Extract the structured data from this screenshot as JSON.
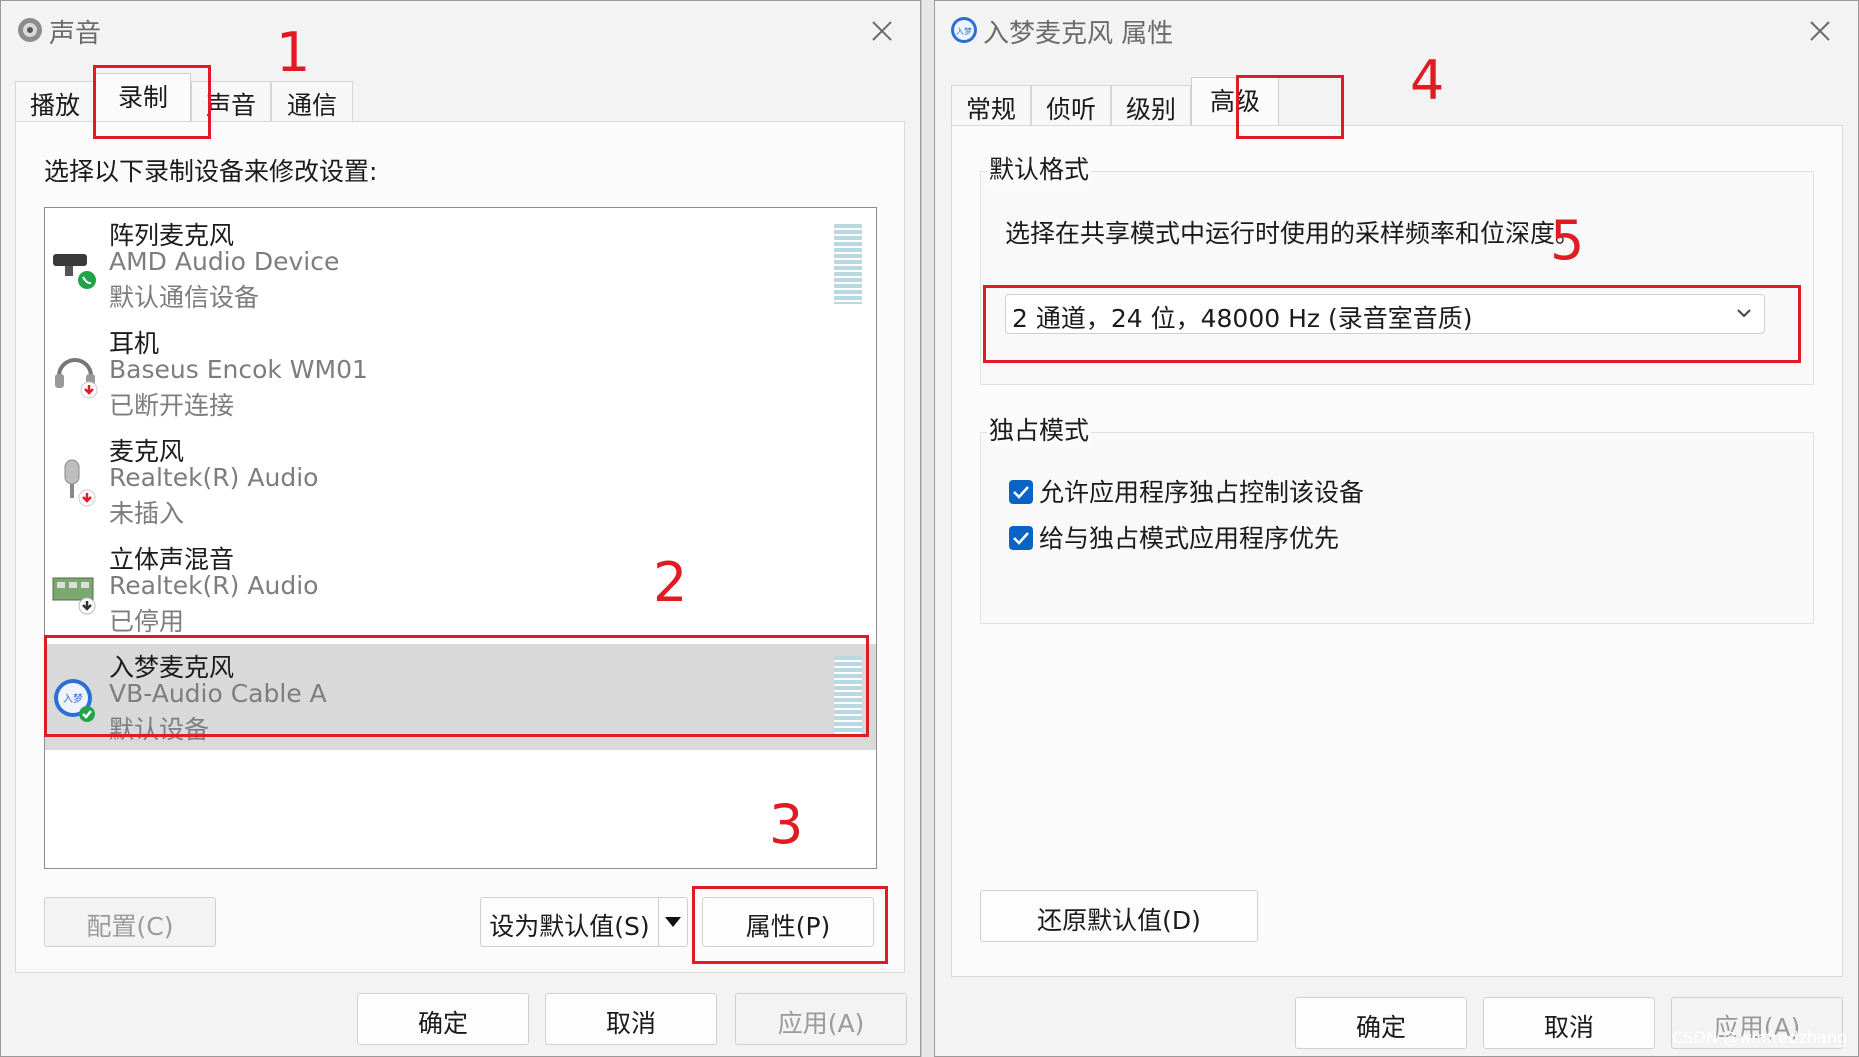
{
  "left_window": {
    "title": "声音",
    "tabs": [
      "播放",
      "录制",
      "声音",
      "通信"
    ],
    "active_tab": "录制",
    "instruction": "选择以下录制设备来修改设置:",
    "devices": [
      {
        "name": "阵列麦克风",
        "device": "AMD Audio Device",
        "status": "默认通信设备",
        "icon": "webcam-mic-icon",
        "badge": "phone-green-badge-icon"
      },
      {
        "name": "耳机",
        "device": "Baseus Encok WM01",
        "status": "已断开连接",
        "icon": "headset-icon",
        "badge": "arrow-red-badge-icon"
      },
      {
        "name": "麦克风",
        "device": "Realtek(R) Audio",
        "status": "未插入",
        "icon": "microphone-icon",
        "badge": "arrow-red-badge-icon"
      },
      {
        "name": "立体声混音",
        "device": "Realtek(R) Audio",
        "status": "已停用",
        "icon": "sound-card-icon",
        "badge": "arrow-down-badge-icon"
      },
      {
        "name": "入梦麦克风",
        "device": "VB-Audio Cable A",
        "status": "默认设备",
        "icon": "vb-audio-icon",
        "badge": "check-green-badge-icon",
        "selected": true
      }
    ],
    "buttons": {
      "configure": "配置(C)",
      "set_default": "设为默认值(S)",
      "properties": "属性(P)",
      "ok": "确定",
      "cancel": "取消",
      "apply": "应用(A)"
    },
    "annotations": [
      "1",
      "2",
      "3"
    ]
  },
  "right_window": {
    "title": "入梦麦克风 属性",
    "tabs": [
      "常规",
      "侦听",
      "级别",
      "高级"
    ],
    "active_tab": "高级",
    "default_format": {
      "legend": "默认格式",
      "description": "选择在共享模式中运行时使用的采样频率和位深度。",
      "selected_value": "2 通道，24 位，48000 Hz (录音室音质)"
    },
    "exclusive_mode": {
      "legend": "独占模式",
      "options": [
        {
          "label": "允许应用程序独占控制该设备",
          "checked": true
        },
        {
          "label": "给与独占模式应用程序优先",
          "checked": true
        }
      ]
    },
    "buttons": {
      "restore_defaults": "还原默认值(D)",
      "ok": "确定",
      "cancel": "取消",
      "apply": "应用(A)"
    },
    "annotations": [
      "4",
      "5"
    ]
  },
  "watermark": "CSDN @winfredzhang",
  "colors": {
    "annotation_red": "#e01b24",
    "checkbox_blue": "#0a64c6",
    "selected_row": "#d9d9d9"
  }
}
